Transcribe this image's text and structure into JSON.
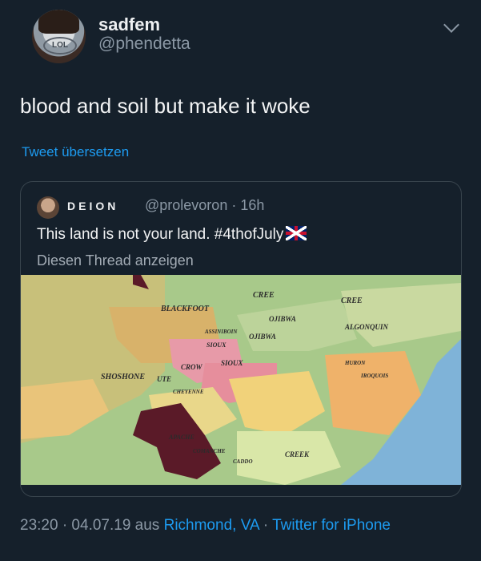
{
  "author": {
    "display_name": "sadfem",
    "handle": "@phendetta",
    "avatar_badge": "LOL"
  },
  "tweet": {
    "text": "blood and soil but make it woke",
    "translate_label": "Tweet übersetzen"
  },
  "quoted": {
    "display_name": "DEION",
    "handle_time": "@prolevoron · 16h",
    "text": "This land is not your land. #4thofJuly",
    "flag_emoji": "uk-flag-icon",
    "show_thread": "Diesen Thread anzeigen",
    "map_labels": {
      "cree1": "CREE",
      "cree2": "CREE",
      "blackfoot": "BLACKFOOT",
      "ojibwa1": "OJIBWA",
      "ojibwa2": "OJIBWA",
      "algonquin": "ALGONQUIN",
      "assiniboin": "ASSINIBOIN",
      "sioux1": "SIOUX",
      "sioux2": "SIOUX",
      "crow": "CROW",
      "shoshone": "SHOSHONE",
      "ute": "UTE",
      "cheyenne": "CHEYENNE",
      "apache": "APACHE",
      "creek": "CREEK",
      "caddo": "CADDO",
      "huron": "HURON",
      "iroquois": "IROQUOIS",
      "comanche": "COMANCHE"
    }
  },
  "footer": {
    "time_date": "23:20 · 04.07.19 aus",
    "location": "Richmond, VA",
    "separator": " · ",
    "client": "Twitter for iPhone"
  }
}
